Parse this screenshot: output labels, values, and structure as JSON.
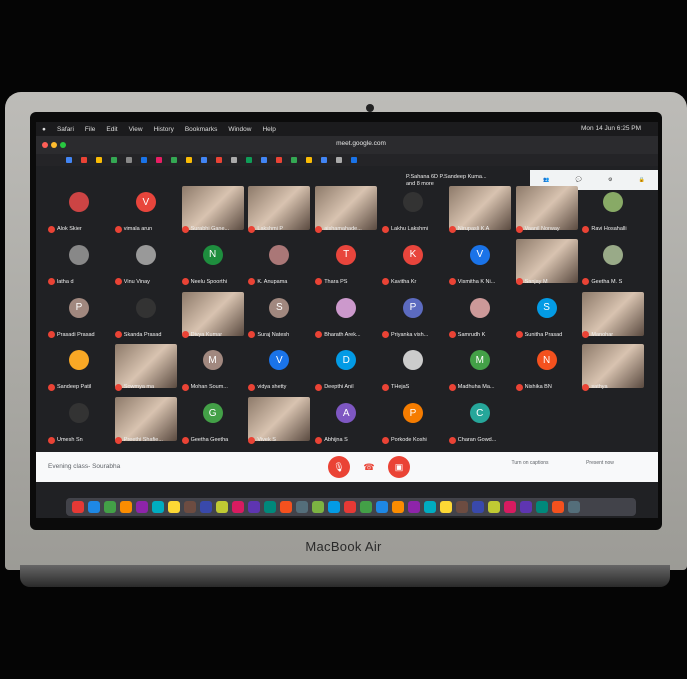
{
  "laptop": {
    "brand_label": "MacBook Air"
  },
  "menubar": {
    "items": [
      "Safari",
      "File",
      "Edit",
      "View",
      "History",
      "Bookmarks",
      "Window",
      "Help"
    ],
    "clock": "Mon 14 Jun  6:25 PM"
  },
  "browser": {
    "url": "meet.google.com"
  },
  "meet": {
    "top_info": [
      "P.Sahana 6D P.Sandeep Kuma...",
      "and 8 more"
    ],
    "participants": [
      {
        "name": "Alok Skier",
        "avatar": "",
        "color": "#c44"
      },
      {
        "name": "vimala arun",
        "avatar": "V",
        "color": "#e8453c"
      },
      {
        "name": "Surabhi Gane...",
        "avatar": "",
        "color": "video"
      },
      {
        "name": "Lakshmi P",
        "avatar": "",
        "color": "video"
      },
      {
        "name": "aishamahade...",
        "avatar": "",
        "color": "video"
      },
      {
        "name": "Lakhu Lakshmi",
        "avatar": "",
        "color": "#333"
      },
      {
        "name": "Nirupasli K A",
        "avatar": "",
        "color": "video"
      },
      {
        "name": "Vaanil Norway",
        "avatar": "",
        "color": "video"
      },
      {
        "name": "Ravi Hosahalli",
        "avatar": "",
        "color": "#8a6"
      },
      {
        "name": "latha d",
        "avatar": "",
        "color": "#888"
      },
      {
        "name": "Vinu Vinay",
        "avatar": "",
        "color": "#999"
      },
      {
        "name": "Neelu Spoorthi",
        "avatar": "N",
        "color": "#1e8e3e"
      },
      {
        "name": "K. Anupama",
        "avatar": "",
        "color": "#a77"
      },
      {
        "name": "Thara PS",
        "avatar": "T",
        "color": "#e8453c"
      },
      {
        "name": "Kavitha Kr",
        "avatar": "K",
        "color": "#e8453c"
      },
      {
        "name": "Vismitha K Ni...",
        "avatar": "V",
        "color": "#1a73e8"
      },
      {
        "name": "Sanjay M",
        "avatar": "",
        "color": "video"
      },
      {
        "name": "Geetha M. S",
        "avatar": "",
        "color": "#9a8"
      },
      {
        "name": "Prasadi Prasad",
        "avatar": "P",
        "color": "#a1887f"
      },
      {
        "name": "Skanda Prasad",
        "avatar": "",
        "color": "#333"
      },
      {
        "name": "Divya Kumar",
        "avatar": "",
        "color": "video"
      },
      {
        "name": "Suraj Natesh",
        "avatar": "S",
        "color": "#a1887f"
      },
      {
        "name": "Bharath Arek...",
        "avatar": "",
        "color": "#c9c"
      },
      {
        "name": "Priyanka vish...",
        "avatar": "P",
        "color": "#5c6bc0"
      },
      {
        "name": "Samrudh K",
        "avatar": "",
        "color": "#c99"
      },
      {
        "name": "Sunitha Prasad",
        "avatar": "S",
        "color": "#039be5"
      },
      {
        "name": "Manohar",
        "avatar": "",
        "color": "video"
      },
      {
        "name": "Sandeep Patil",
        "avatar": "",
        "color": "#f9a825"
      },
      {
        "name": "Sowmya ma",
        "avatar": "",
        "color": "video"
      },
      {
        "name": "Mohan Soum...",
        "avatar": "M",
        "color": "#a1887f"
      },
      {
        "name": "vidya shetty",
        "avatar": "V",
        "color": "#1a73e8"
      },
      {
        "name": "Deepthi Anil",
        "avatar": "D",
        "color": "#039be5"
      },
      {
        "name": "THejaS",
        "avatar": "",
        "color": "#ccc"
      },
      {
        "name": "Madhuha Ma...",
        "avatar": "M",
        "color": "#43a047"
      },
      {
        "name": "Nishika BN",
        "avatar": "N",
        "color": "#f4511e"
      },
      {
        "name": "sathya",
        "avatar": "",
        "color": "video"
      },
      {
        "name": "Umesh Sn",
        "avatar": "",
        "color": "#333"
      },
      {
        "name": "Preethi Shafie...",
        "avatar": "",
        "color": "video"
      },
      {
        "name": "Geetha Geetha",
        "avatar": "G",
        "color": "#43a047"
      },
      {
        "name": "Vivek S",
        "avatar": "",
        "color": "video"
      },
      {
        "name": "Abhijna S",
        "avatar": "A",
        "color": "#7e57c2"
      },
      {
        "name": "Porkode Koshi",
        "avatar": "P",
        "color": "#f57c00"
      },
      {
        "name": "Charan Gowd...",
        "avatar": "C",
        "color": "#26a69a"
      }
    ],
    "meeting_name": "Evening class- Sourabha",
    "turn_on_captions": "Turn on captions",
    "present_now": "Present now"
  }
}
